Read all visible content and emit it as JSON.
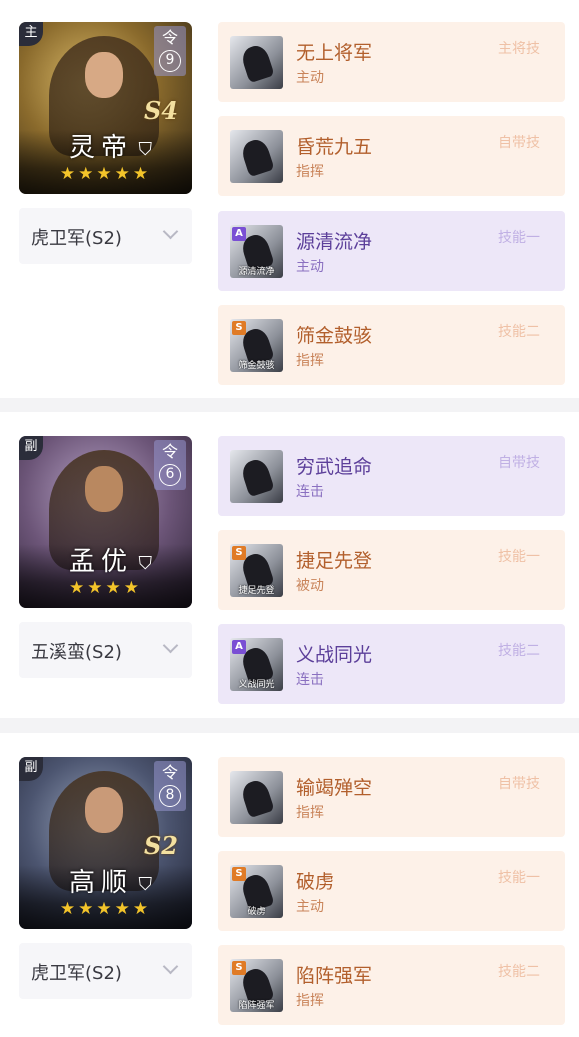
{
  "generals": [
    {
      "role": "主",
      "order": "令",
      "order_num": "9",
      "season": "S4",
      "name": "灵帝",
      "stars": "★★★★★",
      "star_count": 5,
      "theme": "gold",
      "troop": "虎卫军(S2)",
      "skills": [
        {
          "name": "无上将军",
          "type": "主动",
          "slot": "主将技",
          "grade": "",
          "caption": "",
          "color": "peach"
        },
        {
          "name": "昏荒九五",
          "type": "指挥",
          "slot": "自带技",
          "grade": "",
          "caption": "",
          "color": "peach"
        },
        {
          "name": "源清流净",
          "type": "主动",
          "slot": "技能一",
          "grade": "A",
          "caption": "源清流净",
          "color": "lav"
        },
        {
          "name": "筛金鼓骇",
          "type": "指挥",
          "slot": "技能二",
          "grade": "S",
          "caption": "筛金鼓骇",
          "color": "peach"
        }
      ]
    },
    {
      "role": "副",
      "order": "令",
      "order_num": "6",
      "season": "",
      "name": "孟优",
      "stars": "★★★★",
      "star_count": 4,
      "theme": "purple",
      "troop": "五溪蛮(S2)",
      "skills": [
        {
          "name": "穷武追命",
          "type": "连击",
          "slot": "自带技",
          "grade": "",
          "caption": "",
          "color": "lav"
        },
        {
          "name": "捷足先登",
          "type": "被动",
          "slot": "技能一",
          "grade": "S",
          "caption": "捷足先登",
          "color": "peach"
        },
        {
          "name": "义战同光",
          "type": "连击",
          "slot": "技能二",
          "grade": "A",
          "caption": "义战同光",
          "color": "lav"
        }
      ]
    },
    {
      "role": "副",
      "order": "令",
      "order_num": "8",
      "season": "S2",
      "name": "高顺",
      "stars": "★★★★★",
      "star_count": 5,
      "theme": "blue",
      "troop": "虎卫军(S2)",
      "skills": [
        {
          "name": "输竭殚空",
          "type": "指挥",
          "slot": "自带技",
          "grade": "",
          "caption": "",
          "color": "peach"
        },
        {
          "name": "破虏",
          "type": "主动",
          "slot": "技能一",
          "grade": "S",
          "caption": "破虏",
          "color": "peach"
        },
        {
          "name": "陷阵强军",
          "type": "指挥",
          "slot": "技能二",
          "grade": "S",
          "caption": "陷阵强军",
          "color": "peach"
        }
      ]
    }
  ],
  "icons": {
    "shield": "shield-icon",
    "star": "star-icon",
    "chevron": "chevron-down-icon"
  },
  "colors": {
    "peach_bg": "#fdf1e8",
    "lavender_bg": "#ede7f8",
    "star": "#f3c42a",
    "grade_s": "#e07b26",
    "grade_a": "#7a4fd4"
  }
}
